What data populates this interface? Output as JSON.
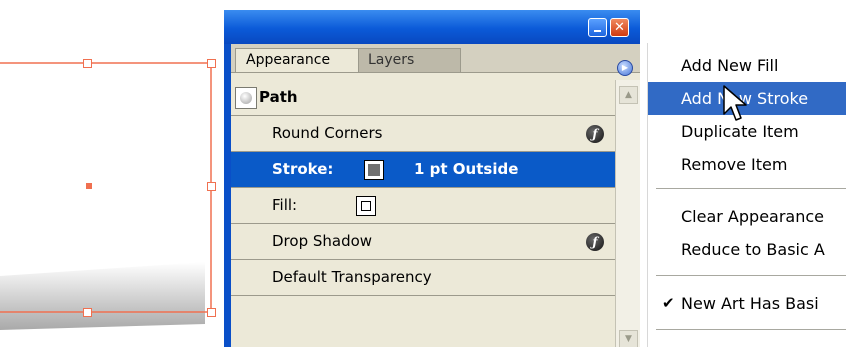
{
  "palette": {
    "tabs": [
      {
        "label": "Appearance",
        "active": true
      },
      {
        "label": "Layers",
        "active": false
      }
    ],
    "rows": {
      "path": "Path",
      "round_corners": "Round Corners",
      "stroke_label": "Stroke:",
      "stroke_value": "1 pt Outside",
      "fill_label": "Fill:",
      "drop_shadow": "Drop Shadow",
      "transparency": "Default Transparency"
    },
    "selected_row": "stroke",
    "colors": {
      "titlebar": "#0b5ad8",
      "selection": "#0a5ac8",
      "panel_bg": "#ece9d8",
      "artwork_stroke": "#f07050"
    }
  },
  "menu": {
    "items": [
      {
        "label": "Add New Fill"
      },
      {
        "label": "Add New Stroke",
        "highlighted": true
      },
      {
        "label": "Duplicate Item"
      },
      {
        "label": "Remove Item"
      },
      {
        "label": "Clear Appearance"
      },
      {
        "label": "Reduce to Basic A"
      },
      {
        "label": "New Art Has Basi",
        "checked": true
      }
    ],
    "highlight_color": "#316ac5"
  },
  "icons": {
    "minimize": "minimize-icon",
    "close": "close-icon",
    "palette_menu": "flyout-arrow-icon",
    "effect": "fx-icon",
    "check": "checkmark-icon",
    "cursor": "arrow-cursor-icon"
  }
}
